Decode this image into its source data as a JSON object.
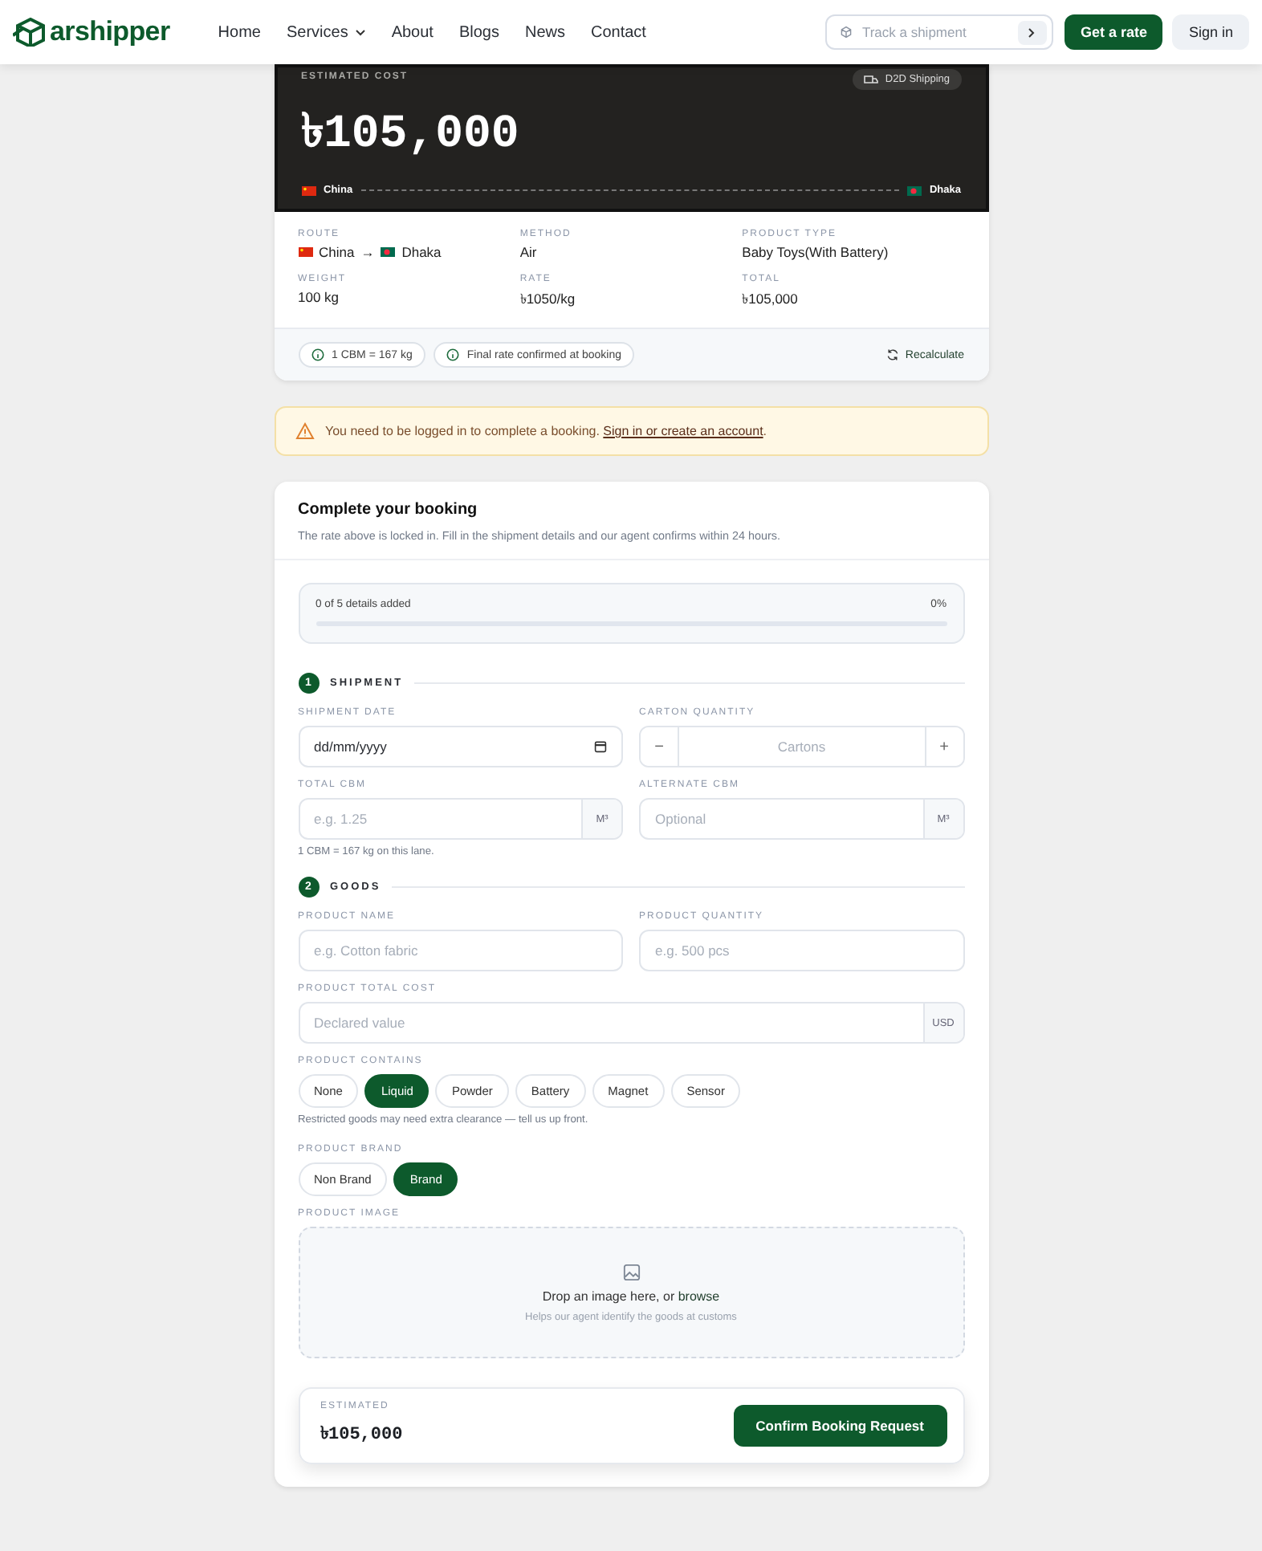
{
  "header": {
    "brand": "arshipper",
    "nav": [
      {
        "label": "Home",
        "dropdown": false
      },
      {
        "label": "Services",
        "dropdown": true
      },
      {
        "label": "About",
        "dropdown": false
      },
      {
        "label": "Blogs",
        "dropdown": false
      },
      {
        "label": "News",
        "dropdown": false
      },
      {
        "label": "Contact",
        "dropdown": false
      }
    ],
    "track": {
      "placeholder": "Track a shipment"
    },
    "primary_button": "Get a rate",
    "secondary_button": "Sign in"
  },
  "estimate": {
    "label": "ESTIMATED COST",
    "badge": "D2D Shipping",
    "amount": "৳105,000",
    "origin": "China",
    "destination": "Dhaka"
  },
  "details": [
    {
      "label": "ROUTE",
      "kind": "route",
      "origin": "China",
      "arrow": "→",
      "destination": "Dhaka"
    },
    {
      "label": "METHOD",
      "kind": "text",
      "value": "Air"
    },
    {
      "label": "PRODUCT TYPE",
      "kind": "text",
      "value": "Baby Toys(With Battery)"
    },
    {
      "label": "WEIGHT",
      "kind": "text",
      "value": "100 kg"
    },
    {
      "label": "RATE",
      "kind": "text",
      "value": "৳1050/kg"
    },
    {
      "label": "TOTAL",
      "kind": "text",
      "value": "৳105,000"
    }
  ],
  "info_chips": [
    "1 CBM = 167 kg",
    "Final rate confirmed at booking"
  ],
  "recalculate": "Recalculate",
  "alert": {
    "text": "You need to be logged in to complete a booking. ",
    "link": "Sign in or create an account",
    "end": "."
  },
  "booking": {
    "title": "Complete your booking",
    "subtitle": "The rate above is locked in. Fill in the shipment details and our agent confirms within 24 hours.",
    "progress": {
      "label": "0 of 5 details added",
      "percent": "0%",
      "level": 0
    },
    "sections": [
      {
        "number": "1",
        "title": "SHIPMENT",
        "rows": [
          {
            "kind": "fields",
            "fields": [
              {
                "kind": "date",
                "label": "SHIPMENT DATE",
                "value": "dd/mm/yyyy"
              },
              {
                "kind": "stepper",
                "label": "CARTON QUANTITY",
                "minus": "−",
                "placeholder": "Cartons",
                "plus": "+"
              }
            ]
          },
          {
            "kind": "fields",
            "fields": [
              {
                "kind": "unit",
                "label": "TOTAL CBM",
                "placeholder": "e.g. 1.25",
                "unit": "M³"
              },
              {
                "kind": "unit",
                "label": "ALTERNATE CBM",
                "placeholder": "Optional",
                "unit": "M³"
              }
            ]
          },
          {
            "kind": "note",
            "text": "1 CBM = 167 kg on this lane."
          }
        ]
      },
      {
        "number": "2",
        "title": "GOODS",
        "rows": [
          {
            "kind": "fields",
            "fields": [
              {
                "kind": "text",
                "label": "PRODUCT NAME",
                "placeholder": "e.g. Cotton fabric"
              },
              {
                "kind": "text",
                "label": "PRODUCT QUANTITY",
                "placeholder": "e.g. 500 pcs"
              }
            ]
          },
          {
            "kind": "fields",
            "fields": [
              {
                "kind": "unit",
                "label": "PRODUCT TOTAL COST",
                "placeholder": "Declared value",
                "unit": "USD"
              }
            ]
          },
          {
            "kind": "fields",
            "fields": [
              {
                "kind": "chips",
                "label": "PRODUCT CONTAINS",
                "options": [
                  {
                    "label": "None",
                    "selected": false
                  },
                  {
                    "label": "Liquid",
                    "selected": true
                  },
                  {
                    "label": "Powder",
                    "selected": false
                  },
                  {
                    "label": "Battery",
                    "selected": false
                  },
                  {
                    "label": "Magnet",
                    "selected": false
                  },
                  {
                    "label": "Sensor",
                    "selected": false
                  }
                ]
              }
            ]
          },
          {
            "kind": "note",
            "text": "Restricted goods may need extra clearance — tell us up front."
          },
          {
            "kind": "fields",
            "fields": [
              {
                "kind": "chips",
                "label": "PRODUCT BRAND",
                "options": [
                  {
                    "label": "Non Brand",
                    "selected": false
                  },
                  {
                    "label": "Brand",
                    "selected": true
                  }
                ]
              }
            ]
          },
          {
            "kind": "fields",
            "fields": [
              {
                "kind": "upload",
                "label": "PRODUCT IMAGE",
                "text": "Drop an image here, or ",
                "link": "browse",
                "hint": "Helps our agent identify the goods at customs"
              }
            ]
          }
        ]
      }
    ],
    "footer": {
      "label": "ESTIMATED",
      "amount": "৳105,000",
      "button": "Confirm Booking Request"
    }
  }
}
